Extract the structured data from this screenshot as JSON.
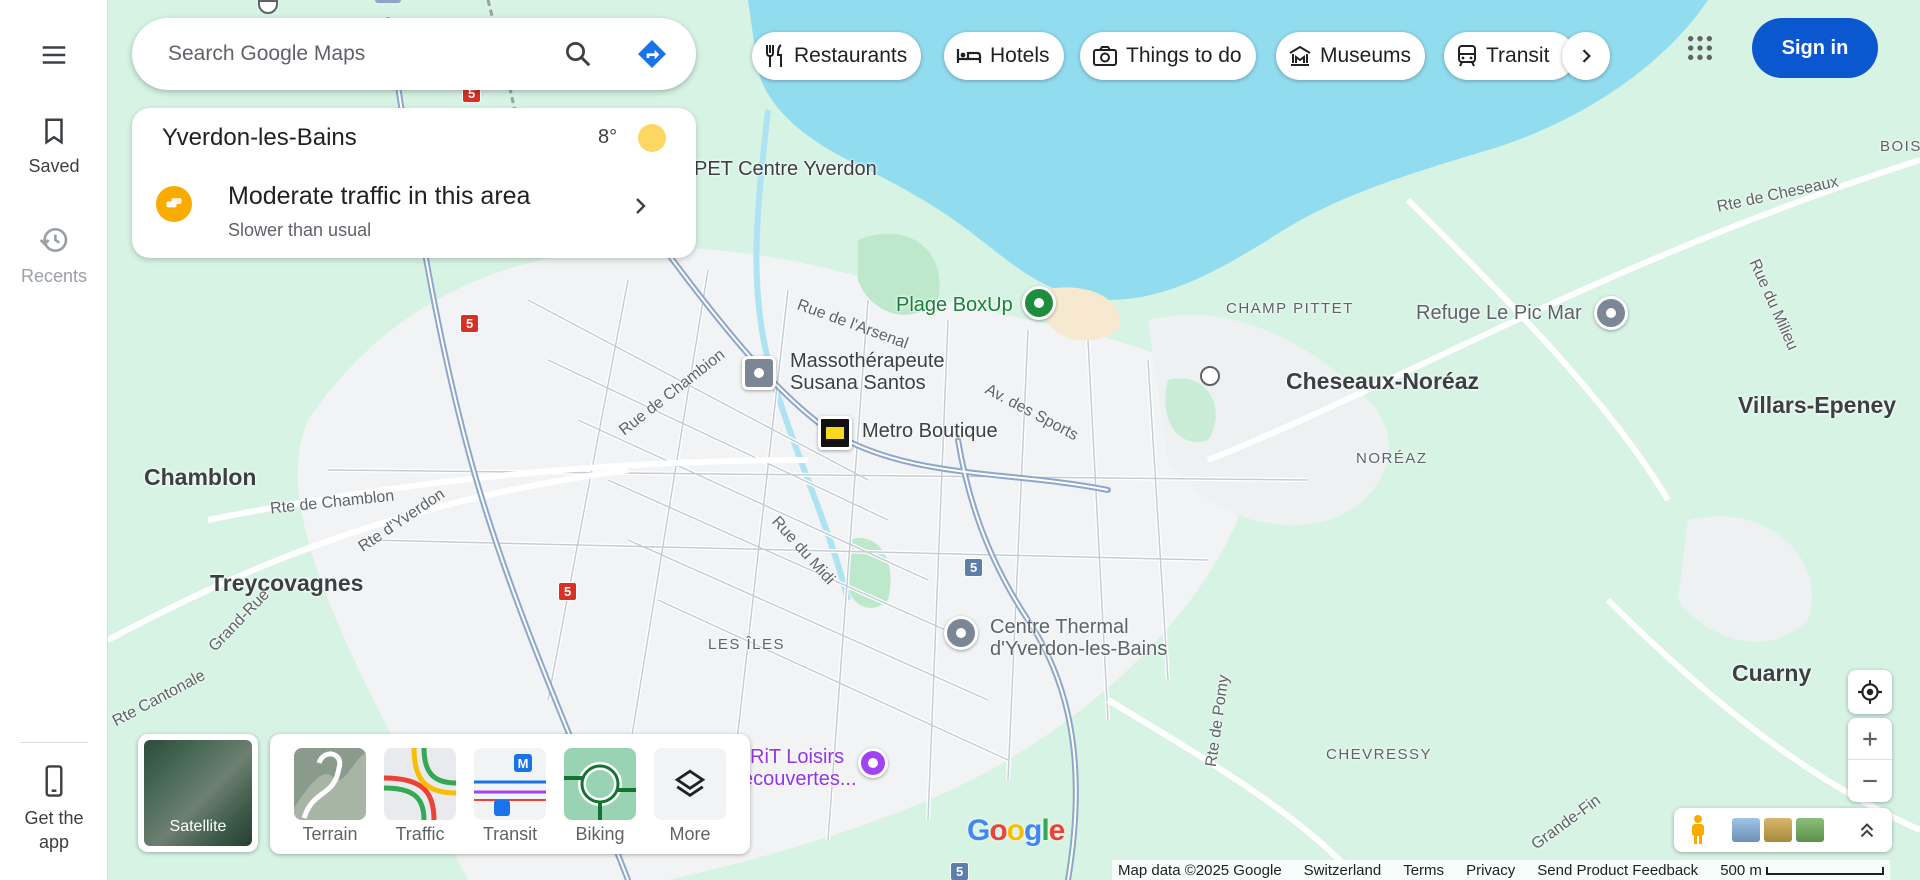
{
  "rail": {
    "saved_label": "Saved",
    "recents_label": "Recents",
    "get_app_label": "Get the app"
  },
  "search": {
    "placeholder": "Search Google Maps"
  },
  "info_card": {
    "city": "Yverdon-les-Bains",
    "temperature": "8°",
    "traffic_title": "Moderate traffic in this area",
    "traffic_subtitle": "Slower than usual"
  },
  "chips": [
    {
      "label": "Restaurants",
      "icon": "fork-knife-icon"
    },
    {
      "label": "Hotels",
      "icon": "bed-icon"
    },
    {
      "label": "Things to do",
      "icon": "camera-icon"
    },
    {
      "label": "Museums",
      "icon": "museum-icon"
    },
    {
      "label": "Transit",
      "icon": "train-icon"
    }
  ],
  "header": {
    "sign_in_label": "Sign in"
  },
  "map": {
    "places": {
      "chamblon": "Chamblon",
      "treycovagnes": "Treycovagnes",
      "les_iles": "LES ÎLES",
      "cheseaux": "Cheseaux-Noréaz",
      "noreaz": "NORÉAZ",
      "villars": "Villars-Epeney",
      "cuarny": "Cuarny",
      "chevressy": "CHEVRESSY",
      "champ_pittet": "CHAMP PITTET",
      "bois": "BOIS C"
    },
    "pois": {
      "pet": "PET Centre Yverdon",
      "plage": "Plage BoxUp",
      "refuge": "Refuge Le Pic Mar",
      "massage_1": "Massothérapeute",
      "massage_2": "Susana Santos",
      "metro": "Metro Boutique",
      "thermal_1": "Centre Thermal",
      "thermal_2": "d'Yverdon-les-Bains",
      "rit_1": "RiT Loisirs",
      "rit_2": "ecouvertes..."
    },
    "streets": {
      "arsenal": "Rue de l'Arsenal",
      "chambion": "Rue de Chambion",
      "sports": "Av. des Sports",
      "midi": "Rue du Midi",
      "rte_chamblon": "Rte de Chamblon",
      "rte_yverdon": "Rte d'Yverdon",
      "grand_rue": "Grand-Rue",
      "cantonale": "Rte Cantonale",
      "pomy": "Rte de Pomy",
      "grande_fin": "Grande-Fin",
      "cheseaux": "Rte de Cheseaux",
      "milieu": "Rue du Milieu"
    },
    "route_number": "5"
  },
  "layers": {
    "satellite_label": "Satellite",
    "items": [
      "Terrain",
      "Traffic",
      "Transit",
      "Biking",
      "More"
    ]
  },
  "footer": {
    "map_data": "Map data ©2025 Google",
    "country": "Switzerland",
    "terms": "Terms",
    "privacy": "Privacy",
    "feedback": "Send Product Feedback",
    "scale": "500 m"
  },
  "colors": {
    "water": "#92dcef",
    "land": "#d6f3e4",
    "urban": "#f1f3f4",
    "road_major": "#8ea7c9",
    "accent": "#0b57d0",
    "traffic_amber": "#f9ab00"
  }
}
